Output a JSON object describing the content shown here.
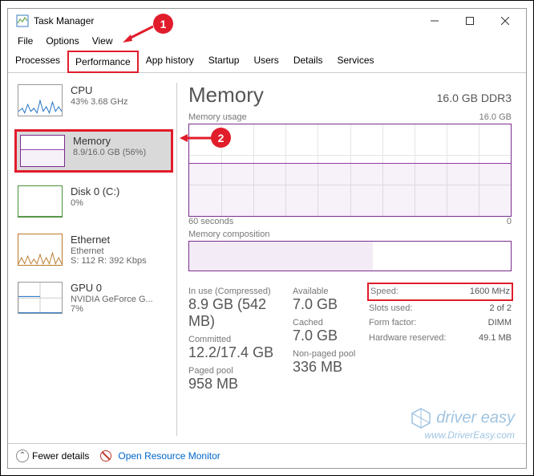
{
  "window": {
    "title": "Task Manager"
  },
  "menu": {
    "file": "File",
    "options": "Options",
    "view": "View"
  },
  "tabs": {
    "processes": "Processes",
    "performance": "Performance",
    "app_history": "App history",
    "startup": "Startup",
    "users": "Users",
    "details": "Details",
    "services": "Services"
  },
  "left": {
    "cpu": {
      "title": "CPU",
      "sub": "43% 3.68 GHz"
    },
    "memory": {
      "title": "Memory",
      "sub": "8.9/16.0 GB (56%)"
    },
    "disk": {
      "title": "Disk 0 (C:)",
      "sub": "0%"
    },
    "eth": {
      "title": "Ethernet",
      "sub1": "Ethernet",
      "sub2": "S: 112 R: 392 Kbps"
    },
    "gpu": {
      "title": "GPU 0",
      "sub1": "NVIDIA GeForce G...",
      "sub2": "7%"
    }
  },
  "right": {
    "title": "Memory",
    "spec": "16.0 GB DDR3",
    "usage_label": "Memory usage",
    "usage_max": "16.0 GB",
    "x_left": "60 seconds",
    "x_right": "0",
    "mc_label": "Memory composition",
    "stats": {
      "in_use_label": "In use (Compressed)",
      "in_use_value": "8.9 GB (542 MB)",
      "available_label": "Available",
      "available_value": "7.0 GB",
      "committed_label": "Committed",
      "committed_value": "12.2/17.4 GB",
      "cached_label": "Cached",
      "cached_value": "7.0 GB",
      "paged_label": "Paged pool",
      "paged_value": "958 MB",
      "nonpaged_label": "Non-paged pool",
      "nonpaged_value": "336 MB"
    },
    "kv": {
      "speed_k": "Speed:",
      "speed_v": "1600 MHz",
      "slots_k": "Slots used:",
      "slots_v": "2 of 2",
      "form_k": "Form factor:",
      "form_v": "DIMM",
      "hw_k": "Hardware reserved:",
      "hw_v": "49.1 MB"
    }
  },
  "footer": {
    "fewer": "Fewer details",
    "orm": "Open Resource Monitor"
  },
  "annot": {
    "b1": "1",
    "b2": "2"
  },
  "watermark": {
    "brand": "driver easy",
    "url": "www.DriverEasy.com"
  }
}
